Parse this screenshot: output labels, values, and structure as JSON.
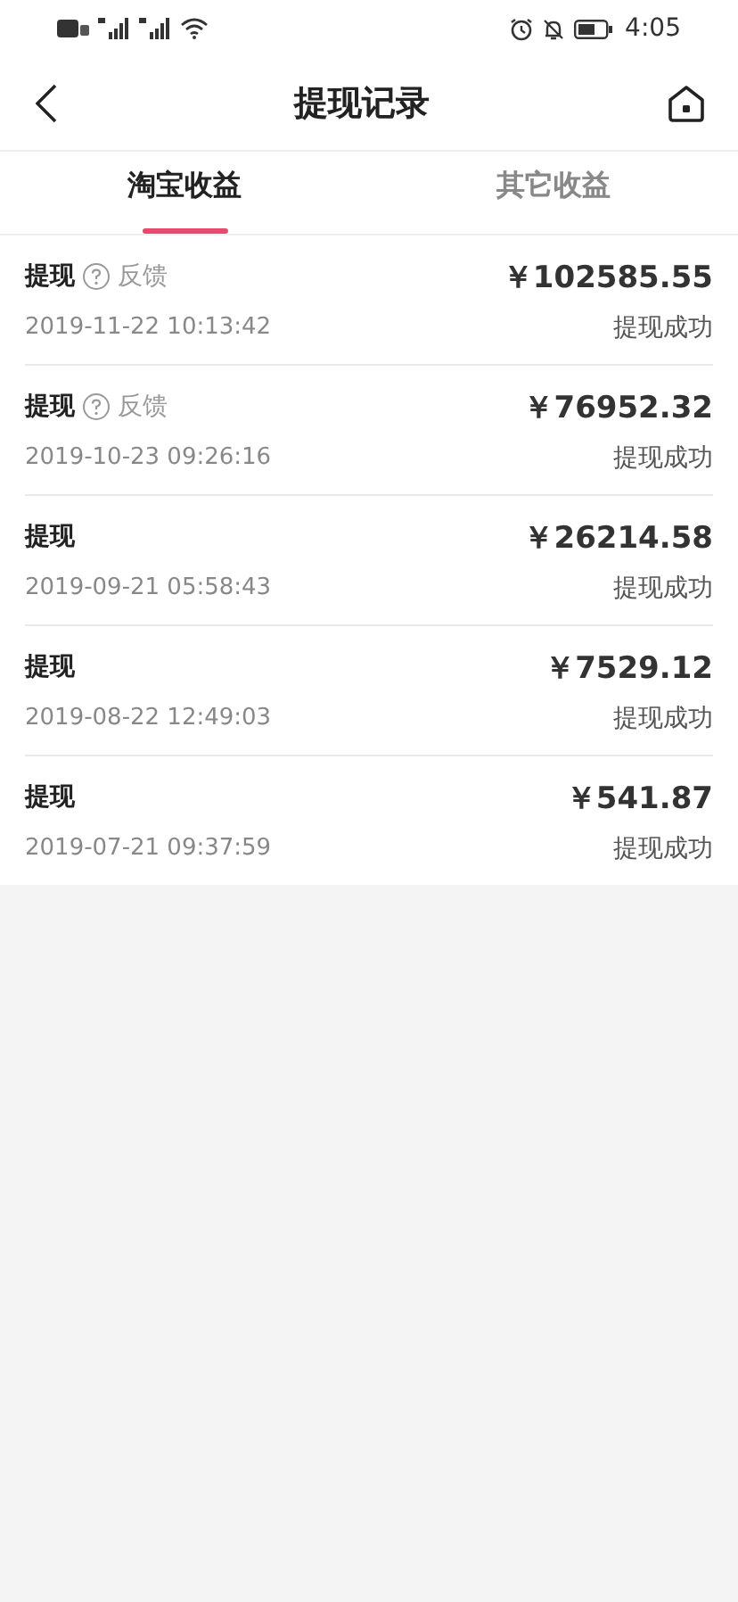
{
  "status_bar": {
    "time": "4:05"
  },
  "header": {
    "title": "提现记录"
  },
  "tabs": [
    {
      "label": "淘宝收益",
      "selected": true
    },
    {
      "label": "其它收益",
      "selected": false
    }
  ],
  "records": [
    {
      "title": "提现",
      "feedback": "反馈",
      "amount": "￥102585.55",
      "time": "2019-11-22 10:13:42",
      "status": "提现成功"
    },
    {
      "title": "提现",
      "feedback": "反馈",
      "amount": "￥76952.32",
      "time": "2019-10-23 09:26:16",
      "status": "提现成功"
    },
    {
      "title": "提现",
      "amount": "￥26214.58",
      "time": "2019-09-21 05:58:43",
      "status": "提现成功"
    },
    {
      "title": "提现",
      "amount": "￥7529.12",
      "time": "2019-08-22 12:49:03",
      "status": "提现成功"
    },
    {
      "title": "提现",
      "amount": "￥541.87",
      "time": "2019-07-21 09:37:59",
      "status": "提现成功"
    }
  ]
}
